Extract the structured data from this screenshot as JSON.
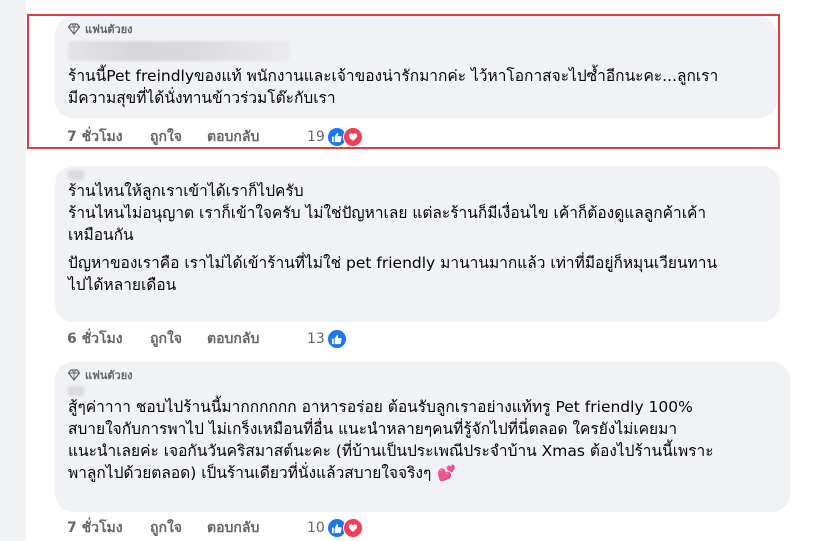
{
  "comments": [
    {
      "badge": "แฟนตัวยง",
      "text": "ร้านนี้Pet freindlyของแท้ พนักงานและเจ้าของน่ารักมากค่ะ ไว้หาโอกาสจะไปซ้ำอีกนะคะ...ลูกเรา\nมีความสุขที่ได้นั่งทานข้าวร่วมโต๊ะกับเรา",
      "time": "7 ชั่วโมง",
      "like": "ถูกใจ",
      "reply": "ตอบกลับ",
      "reaction_count": "19",
      "reactions": [
        "like-icon",
        "love-icon"
      ]
    },
    {
      "paragraphs": [
        "ร้านไหนให้ลูกเราเข้าได้เราก็ไปครับ\nร้านไหนไม่อนุญาต เราก็เข้าใจครับ ไม่ใช่ปัญหาเลย แต่ละร้านก็มีเงื่อนไข เค้าก็ต้องดูแลลูกค้าเค้า\nเหมือนกัน",
        "ปัญหาของเราคือ เราไม่ได้เข้าร้านที่ไม่ใช่ pet friendly มานานมากแล้ว เท่าที่มีอยู่ก็หมุนเวียนทาน\nไปได้หลายเดือน"
      ],
      "time": "6 ชั่วโมง",
      "like": "ถูกใจ",
      "reply": "ตอบกลับ",
      "reaction_count": "13",
      "reactions": [
        "like-icon"
      ]
    },
    {
      "badge": "แฟนตัวยง",
      "text": "สู้ๆค่าาาา ชอบไปร้านนี้มากกกกกก อาหารอร่อย ต้อนรับลูกเราอย่างแท้ทรู Pet friendly 100%\nสบายใจกับการพาไป ไม่เกร็งเหมือนที่อื่น แนะนำหลายๆคนที่รู้จักไปที่นี่ตลอด ใครยังไม่เคยมา\nแนะนำเลยค่ะ เจอกันวันคริสมาสต์นะคะ (ที่บ้านเป็นประเพณีประจำบ้าน Xmas ต้องไปร้านนี้เพราะ\nพาลูกไปด้วยตลอด) เป็นร้านเดียวที่นั่งแล้วสบายใจจริงๆ",
      "emoji": "💕",
      "time": "7 ชั่วโมง",
      "like": "ถูกใจ",
      "reply": "ตอบกลับ",
      "reaction_count": "10",
      "reactions": [
        "like-icon",
        "love-icon"
      ]
    }
  ],
  "colors": {
    "highlight": "#e23d3d",
    "bubble": "#f0f2f5",
    "like": "#1877f2",
    "love": "#f33e58"
  }
}
